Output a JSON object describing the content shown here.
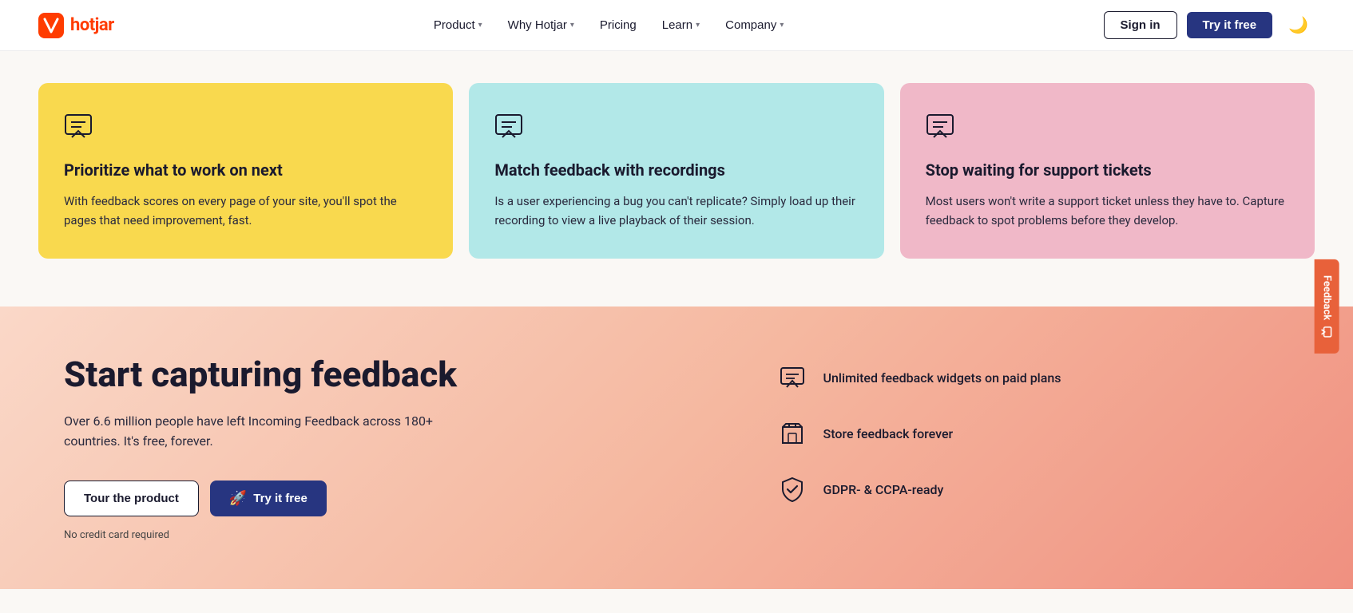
{
  "brand": {
    "name": "hotjar",
    "logo_text": "hotjar"
  },
  "nav": {
    "links": [
      {
        "label": "Product",
        "has_dropdown": true
      },
      {
        "label": "Why Hotjar",
        "has_dropdown": true
      },
      {
        "label": "Pricing",
        "has_dropdown": false
      },
      {
        "label": "Learn",
        "has_dropdown": true
      },
      {
        "label": "Company",
        "has_dropdown": true
      }
    ],
    "sign_in_label": "Sign in",
    "try_free_label": "Try it free"
  },
  "cards": [
    {
      "id": "card-1",
      "background": "yellow",
      "title": "Prioritize what to work on next",
      "body": "With feedback scores on every page of your site, you'll spot the pages that need improvement, fast."
    },
    {
      "id": "card-2",
      "background": "teal",
      "title": "Match feedback with recordings",
      "body": "Is a user experiencing a bug you can't replicate? Simply load up their recording to view a live playback of their session."
    },
    {
      "id": "card-3",
      "background": "pink",
      "title": "Stop waiting for support tickets",
      "body": "Most users won't write a support ticket unless they have to. Capture feedback to spot problems before they develop."
    }
  ],
  "cta": {
    "title": "Start capturing feedback",
    "subtitle": "Over 6.6 million people have left Incoming Feedback across 180+ countries. It's free, forever.",
    "tour_label": "Tour the product",
    "try_label": "Try it free",
    "no_cc_label": "No credit card required"
  },
  "features": [
    {
      "label": "Unlimited feedback widgets on paid plans"
    },
    {
      "label": "Store feedback forever"
    },
    {
      "label": "GDPR- & CCPA-ready"
    }
  ],
  "feedback_tab": {
    "label": "Feedback"
  }
}
